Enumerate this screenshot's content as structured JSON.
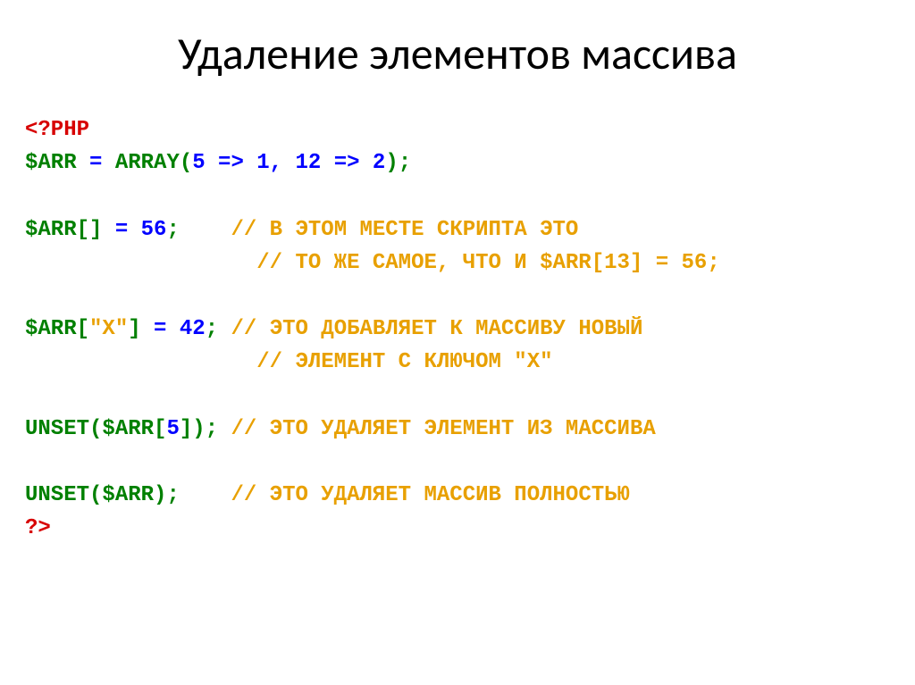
{
  "slide": {
    "title": "Удаление элементов массива"
  },
  "code": {
    "phpOpen": "<?PHP",
    "line1": {
      "var": "$ARR",
      "eq": " = ",
      "func": "ARRAY",
      "open": "(",
      "k1": "5",
      "arrow1": " => ",
      "v1": "1",
      "comma": ", ",
      "k2": "12",
      "arrow2": " => ",
      "v2": "2",
      "close": ")",
      "semi": ";"
    },
    "line2": {
      "var": "$ARR",
      "brOpen": "[",
      "brClose": "]",
      "eq": " = ",
      "val": "56",
      "semi": ";",
      "pad": "    ",
      "c1": "// В ЭТОМ МЕСТЕ СКРИПТА ЭТО",
      "c2pad": "                  ",
      "c2": "// ТО ЖЕ САМОЕ, ЧТО И $ARR[13] = 56;"
    },
    "line3": {
      "var": "$ARR",
      "brOpen": "[",
      "key": "\"X\"",
      "brClose": "]",
      "eq": " = ",
      "val": "42",
      "semi": ";",
      "pad": " ",
      "c1": "// ЭТО ДОБАВЛЯЕТ К МАССИВУ НОВЫЙ",
      "c2pad": "                  ",
      "c2": "// ЭЛЕМЕНТ С КЛЮЧОМ \"X\""
    },
    "line4": {
      "func": "UNSET",
      "open": "(",
      "var": "$ARR",
      "brOpen": "[",
      "idx": "5",
      "brClose": "]",
      "close": ")",
      "semi": ";",
      "pad": " ",
      "c1": "// ЭТО УДАЛЯЕТ ЭЛЕМЕНТ ИЗ МАССИВА"
    },
    "line5": {
      "func": "UNSET",
      "open": "(",
      "var": "$ARR",
      "close": ")",
      "semi": ";",
      "pad": "    ",
      "c1": "// ЭТО УДАЛЯЕТ МАССИВ ПОЛНОСТЬЮ"
    },
    "phpClose": "?>"
  }
}
